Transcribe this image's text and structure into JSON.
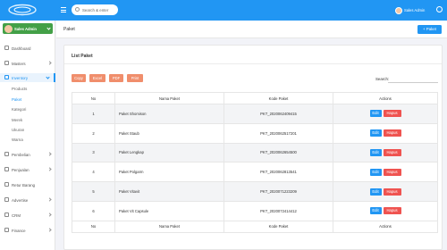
{
  "topbar": {
    "search_placeholder": "Search & enter",
    "user_name": "Sales Admin"
  },
  "sidebar": {
    "profile_name": "Sales Admin",
    "items": [
      {
        "label": "Dashboard"
      },
      {
        "label": "Masters"
      },
      {
        "label": "Inventory"
      },
      {
        "label": "Pembelian"
      },
      {
        "label": "Penjualan"
      },
      {
        "label": "Retur Barang"
      },
      {
        "label": "Advertise"
      },
      {
        "label": "CRM"
      },
      {
        "label": "Finance"
      }
    ],
    "inventory_sub": [
      {
        "label": "Products"
      },
      {
        "label": "Paket"
      },
      {
        "label": "Kategori"
      },
      {
        "label": "Merek"
      },
      {
        "label": "Ukuran"
      },
      {
        "label": "Warna"
      }
    ]
  },
  "header": {
    "title": "Paket",
    "add_button": "+ Paket"
  },
  "card": {
    "title": "List Paket",
    "export_buttons": [
      "Copy",
      "Excel",
      "PDF",
      "Print"
    ],
    "search_label": "Search:",
    "columns": [
      "No",
      "Nama Paket",
      "Kode Paket",
      "Actions"
    ],
    "edit_label": "Edit",
    "delete_label": "Hapus",
    "rows": [
      {
        "no": "1",
        "nama": "Paket Shomison",
        "kode": "PKT_2020062409415"
      },
      {
        "no": "2",
        "nama": "Paket Staub",
        "kode": "PKT_2020062517201"
      },
      {
        "no": "3",
        "nama": "Paket Lengkap",
        "kode": "PKT_2020062654500"
      },
      {
        "no": "4",
        "nama": "Paket Polgarm",
        "kode": "PKT_2020062813541"
      },
      {
        "no": "5",
        "nama": "Paket Vitavit",
        "kode": "PKT_2020071223209"
      },
      {
        "no": "6",
        "nama": "Paket Vit Capsule",
        "kode": "PKT_2020072414412"
      }
    ]
  }
}
